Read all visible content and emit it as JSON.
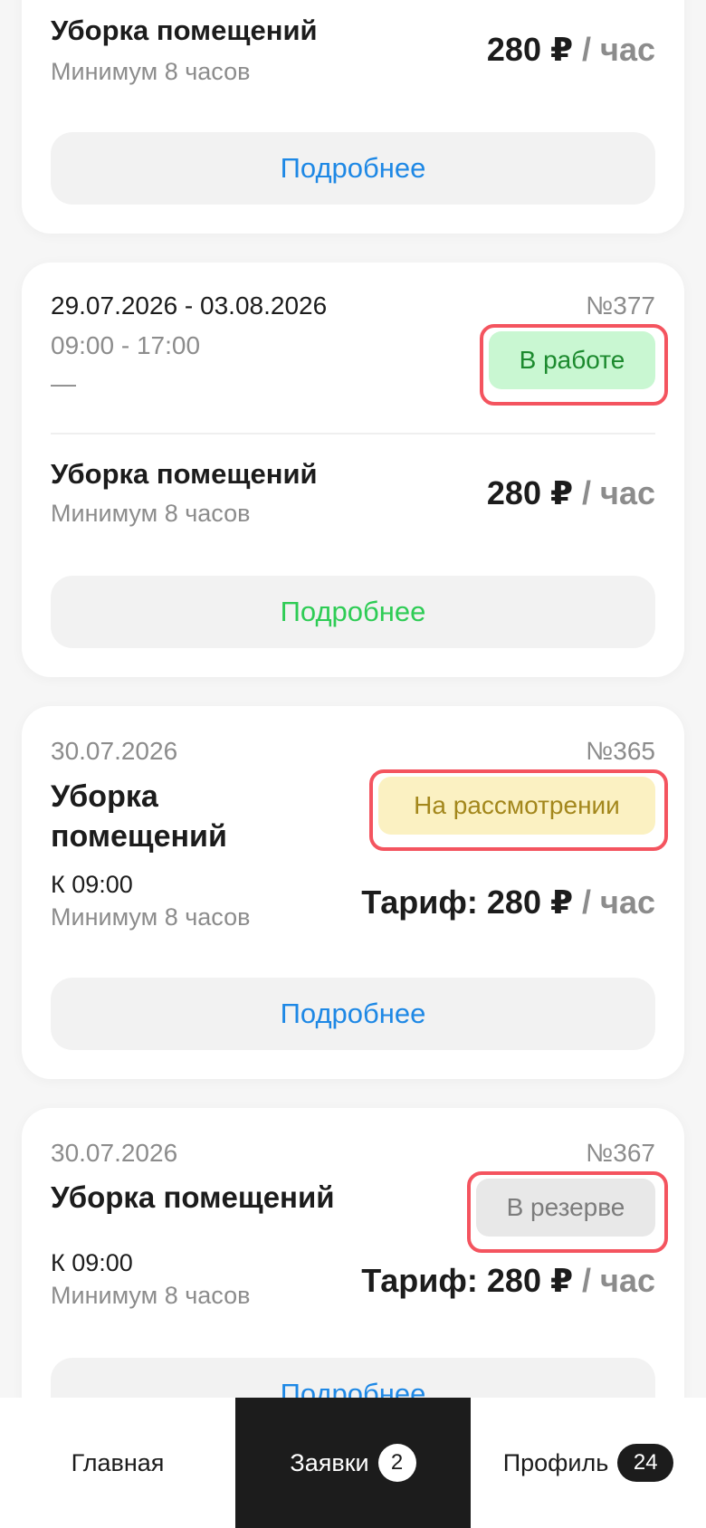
{
  "cards": [
    {
      "service": "Уборка помещений",
      "minimum": "Минимум 8 часов",
      "price": "280 ₽",
      "price_unit": "/ час",
      "button": "Подробнее"
    },
    {
      "dates": "29.07.2026 - 03.08.2026",
      "time": "09:00 - 17:00",
      "dash": "—",
      "number": "№377",
      "status": "В работе",
      "service": "Уборка помещений",
      "minimum": "Минимум 8 часов",
      "price": "280 ₽",
      "price_unit": "/ час",
      "button": "Подробнее"
    },
    {
      "date": "30.07.2026",
      "number": "№365",
      "status": "На рассмотрении",
      "service_line1": "Уборка",
      "service_line2": "помещений",
      "start": "К 09:00",
      "minimum": "Минимум 8 часов",
      "tariff": "Тариф: 280 ₽",
      "price_unit": "/ час",
      "button": "Подробнее"
    },
    {
      "date": "30.07.2026",
      "number": "№367",
      "status": "В резерве",
      "service": "Уборка помещений",
      "start": "К 09:00",
      "minimum": "Минимум 8 часов",
      "tariff": "Тариф: 280 ₽",
      "price_unit": "/ час",
      "button": "Подробнее"
    }
  ],
  "nav": {
    "home": "Главная",
    "requests": "Заявки",
    "requests_count": "2",
    "profile": "Профиль",
    "profile_count": "24"
  },
  "colors": {
    "accent_blue": "#1e88e5",
    "accent_green": "#2ecc55",
    "highlight_red": "#f4545f",
    "nav_active": "#1c1c1c"
  },
  "icons": {}
}
